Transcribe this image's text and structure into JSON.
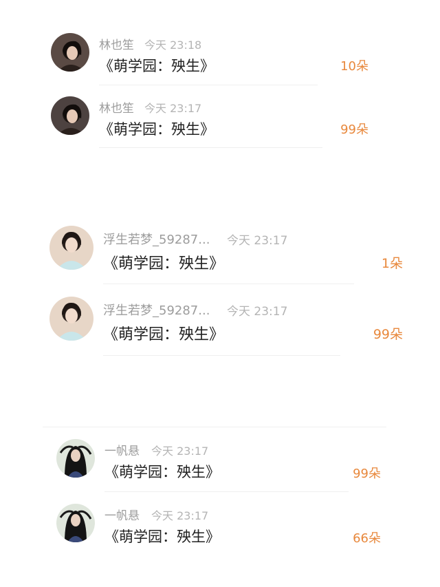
{
  "accent_color": "#e8883c",
  "groups": [
    {
      "entries": [
        {
          "user": "林也笙",
          "time": "今天 23:18",
          "work": "《萌学园：殃生》",
          "flowers": "10朵",
          "avatar_icon": "avatar-girl-dark-hair-icon"
        },
        {
          "user": "林也笙",
          "time": "今天 23:17",
          "work": "《萌学园：殃生》",
          "flowers": "99朵",
          "avatar_icon": "avatar-girl-dark-hair-icon"
        }
      ]
    },
    {
      "entries": [
        {
          "user": "浮生若梦_59287...",
          "time": "今天 23:17",
          "work": "《萌学园：殃生》",
          "flowers": "1朵",
          "avatar_icon": "avatar-girl-light-dress-icon"
        },
        {
          "user": "浮生若梦_59287...",
          "time": "今天 23:17",
          "work": "《萌学园：殃生》",
          "flowers": "99朵",
          "avatar_icon": "avatar-girl-light-dress-icon"
        }
      ]
    },
    {
      "entries": [
        {
          "user": "一帆悬",
          "time": "今天 23:17",
          "work": "《萌学园：殃生》",
          "flowers": "99朵",
          "avatar_icon": "avatar-long-black-hair-icon"
        },
        {
          "user": "一帆悬",
          "time": "今天 23:17",
          "work": "《萌学园：殃生》",
          "flowers": "66朵",
          "avatar_icon": "avatar-long-black-hair-icon"
        }
      ]
    }
  ]
}
